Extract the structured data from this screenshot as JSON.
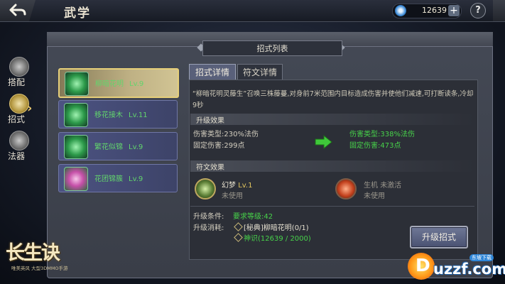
{
  "header": {
    "title": "武学",
    "currency_value": "12639",
    "add_label": "+",
    "help_label": "?"
  },
  "sidebar": {
    "items": [
      {
        "label": "搭配"
      },
      {
        "label": "招式"
      },
      {
        "label": "法器"
      }
    ]
  },
  "panel": {
    "list_header": "招式列表"
  },
  "skills": [
    {
      "name": "柳暗花明",
      "level": "Lv.9"
    },
    {
      "name": "移花接木",
      "level": "Lv.11"
    },
    {
      "name": "繁花似锦",
      "level": "Lv.9"
    },
    {
      "name": "花团锦簇",
      "level": "Lv.9"
    }
  ],
  "tabs": {
    "detail": "招式详情",
    "rune": "符文详情"
  },
  "detail": {
    "description": "“柳暗花明灵藤生”召唤三株藤蔓,对身前7米范围内目标造成伤害并使他们减速,可打断读条,冷却9秒",
    "upgrade_effect_title": "升级效果",
    "current": {
      "damage_type": "伤害类型:230%法伤",
      "fixed_damage": "固定伤害:299点"
    },
    "next": {
      "damage_type": "伤害类型:338%法伤",
      "fixed_damage": "固定伤害:473点"
    },
    "rune_effect_title": "符文效果",
    "rune1": {
      "name": "幻梦",
      "level": "Lv.1",
      "status": "未使用"
    },
    "rune2": {
      "name": "生机",
      "state": "未激活",
      "status": "未使用"
    },
    "upgrade_condition_label": "升级条件:",
    "upgrade_condition_value": "要求等级:42",
    "upgrade_cost_label": "升级消耗:",
    "cost1": "[秘典]柳暗花明(0/1)",
    "cost2": "神识(12639 / 2000)",
    "upgrade_button": "升级招式"
  },
  "branding": {
    "logo": "长生诀",
    "subtitle": "唯美英风 大型3DMMO手游",
    "watermark": "uzzf.com",
    "watermark_tag": "东坡下载"
  },
  "colors": {
    "accent_green": "#47d24a",
    "active_gold": "#e6cf79"
  }
}
